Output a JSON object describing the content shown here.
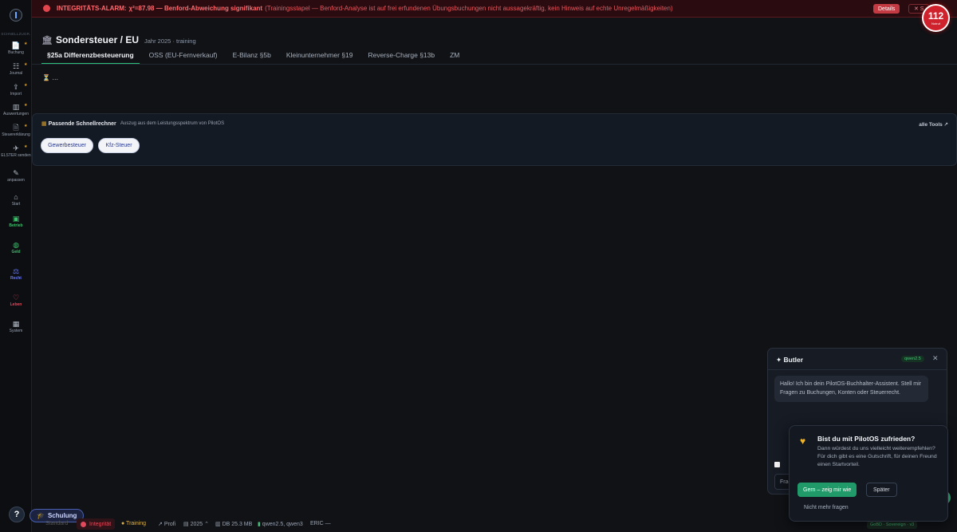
{
  "alarm": {
    "label": "INTEGRITÄTS-ALARM:",
    "text": "χ²=87.98 — Benford-Abweichung signifikant",
    "detail": "(Trainingsstapel — Benford-Analyse ist auf frei erfundenen Übungsbuchungen nicht aussagekräftig, kein Hinweis auf echte Unregelmäßigkeiten)",
    "details_btn": "Details",
    "close_btn": "✕ S"
  },
  "notruf": {
    "number": "112",
    "label": "Notruf"
  },
  "sidebar": {
    "section_label": "SCHNELLZUGR.",
    "items": [
      {
        "label": "Buchung",
        "icon": "📄"
      },
      {
        "label": "Journal",
        "icon": "☷"
      },
      {
        "label": "Import",
        "icon": "⇪"
      },
      {
        "label": "Auswertungen",
        "icon": "▥"
      },
      {
        "label": "Steuererklärung",
        "icon": "🗎"
      },
      {
        "label": "ELSTER senden",
        "icon": "✈"
      },
      {
        "label": "anpassen",
        "icon": "✎"
      },
      {
        "label": "Start",
        "icon": "⌂"
      },
      {
        "label": "Betrieb",
        "icon": "▣"
      },
      {
        "label": "Geld",
        "icon": "◍"
      },
      {
        "label": "Recht",
        "icon": "⚖"
      },
      {
        "label": "Leben",
        "icon": "♡"
      },
      {
        "label": "System",
        "icon": "▦"
      }
    ]
  },
  "header": {
    "title": "Sondersteuer / EU",
    "meta": "Jahr 2025 · training"
  },
  "tabs": [
    "§25a Differenzbesteuerung",
    "OSS (EU-Fernverkauf)",
    "E-Bilanz §5b",
    "Kleinunternehmer §19",
    "Reverse-Charge §13b",
    "ZM"
  ],
  "loading_text": "…",
  "panel": {
    "title": "Passende Schnellrechner",
    "subtitle": "Auszug aus dem Leistungsspektrum von PilotOS",
    "link": "alle Tools ↗",
    "chips": [
      "Gewerbesteuer",
      "Kfz-Steuer"
    ]
  },
  "help_label": "?",
  "schulung_label": "Schulung",
  "statusbar": {
    "standard": "Standard",
    "integritaet": "Integrität",
    "training": "Training",
    "profi": "Profi",
    "year": "2025 ⌃",
    "db": "DB 25.3 MB",
    "models": "qwen2.5, qwen3",
    "eric": "ERIC —",
    "version": "GoBD · Sovereign · v3"
  },
  "butler": {
    "title": "Butler",
    "model": "qwen2.5",
    "message": "Hallo! Ich bin dein PilotOS-Buchhalter-Assistent. Stell mir Fragen zu Buchungen, Konten oder Steuerrecht.",
    "input_placeholder": "Frag"
  },
  "survey": {
    "question": "Bist du mit PilotOS zufrieden?",
    "text": "Dann würdest du uns vielleicht weiterempfehlen? Für dich gibt es eine Gutschrift, für deinen Freund einen Startvorteil.",
    "yes": "Gern – zeig mir wie",
    "later": "Später",
    "never": "Nicht mehr fragen"
  }
}
